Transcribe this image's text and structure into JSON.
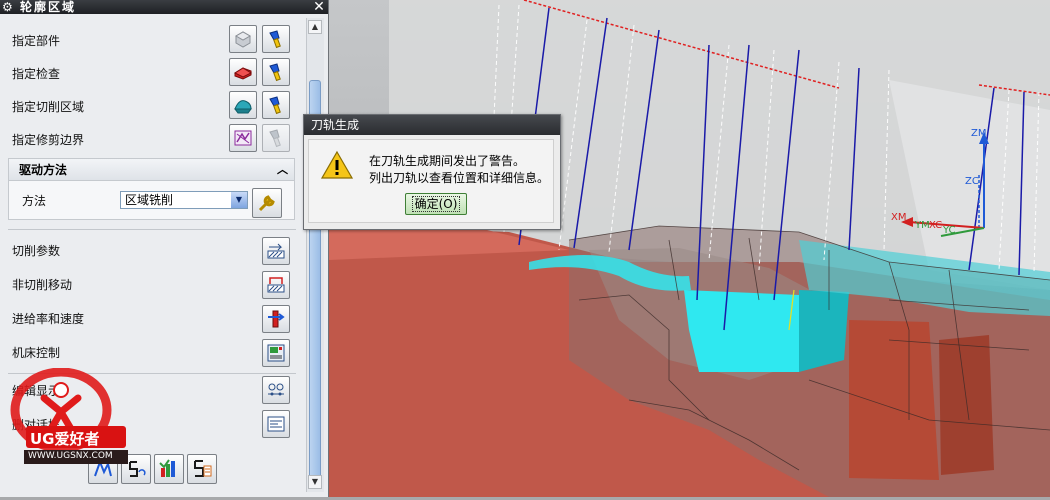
{
  "panel": {
    "title": "轮廓区域",
    "rows": [
      {
        "label": "指定部件"
      },
      {
        "label": "指定检查"
      },
      {
        "label": "指定切削区域"
      },
      {
        "label": "指定修剪边界"
      }
    ],
    "drive": {
      "header": "驱动方法",
      "method_label": "方法",
      "method_value": "区域铣削"
    },
    "options": [
      {
        "label": "切削参数"
      },
      {
        "label": "非切削移动"
      },
      {
        "label": "进给率和速度"
      },
      {
        "label": "机床控制"
      },
      {
        "label": "编辑显示"
      },
      {
        "label": "删对话框"
      }
    ]
  },
  "logo": {
    "text": "UG爱好者",
    "url": "WWW.UGSNX.COM"
  },
  "dialog": {
    "title": "刀轨生成",
    "line1": "在刀轨生成期间发出了警告。",
    "line2": "列出刀轨以查看位置和详细信息。",
    "ok_label": "确定(O)"
  },
  "viewport": {
    "triad_labels": {
      "zm": "ZM",
      "zc": "ZC",
      "xm": "XM",
      "ym": "YM",
      "xc": "XC",
      "yc": "YC"
    }
  },
  "colors": {
    "part_red": "#c0584a",
    "cyan": "#2fe8f0",
    "toolpath_blue": "#1a1aa8",
    "bg_gray": "#a9abad"
  }
}
